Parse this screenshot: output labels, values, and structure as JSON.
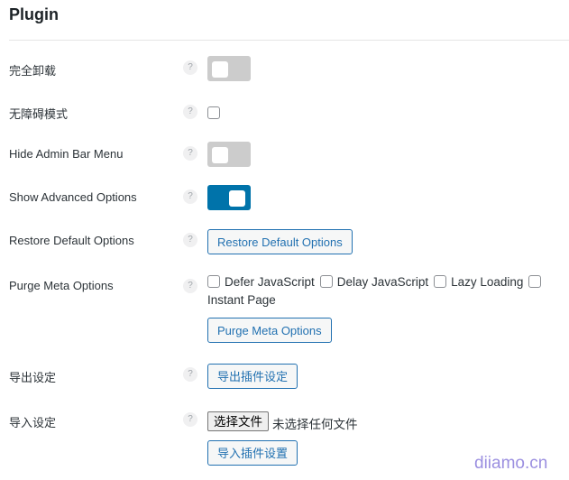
{
  "section": {
    "title": "Plugin"
  },
  "help_glyph": "?",
  "rows": {
    "uninstall": {
      "label": "完全卸载",
      "toggle_on": false
    },
    "accessibility": {
      "label": "无障碍模式",
      "checked": false
    },
    "hide_admin_bar": {
      "label": "Hide Admin Bar Menu",
      "toggle_on": false
    },
    "show_advanced": {
      "label": "Show Advanced Options",
      "toggle_on": true
    },
    "restore": {
      "label": "Restore Default Options",
      "button": "Restore Default Options"
    },
    "purge": {
      "label": "Purge Meta Options",
      "options": [
        "Defer JavaScript",
        "Delay JavaScript",
        "Lazy Loading",
        "Instant Page"
      ],
      "button": "Purge Meta Options"
    },
    "export": {
      "label": "导出设定",
      "button": "导出插件设定"
    },
    "import": {
      "label": "导入设定",
      "file_button": "选择文件",
      "file_status": "未选择任何文件",
      "button": "导入插件设置"
    }
  },
  "colors": {
    "accent": "#0073aa",
    "button_text": "#2271b1"
  },
  "watermark": "diiamo.cn"
}
